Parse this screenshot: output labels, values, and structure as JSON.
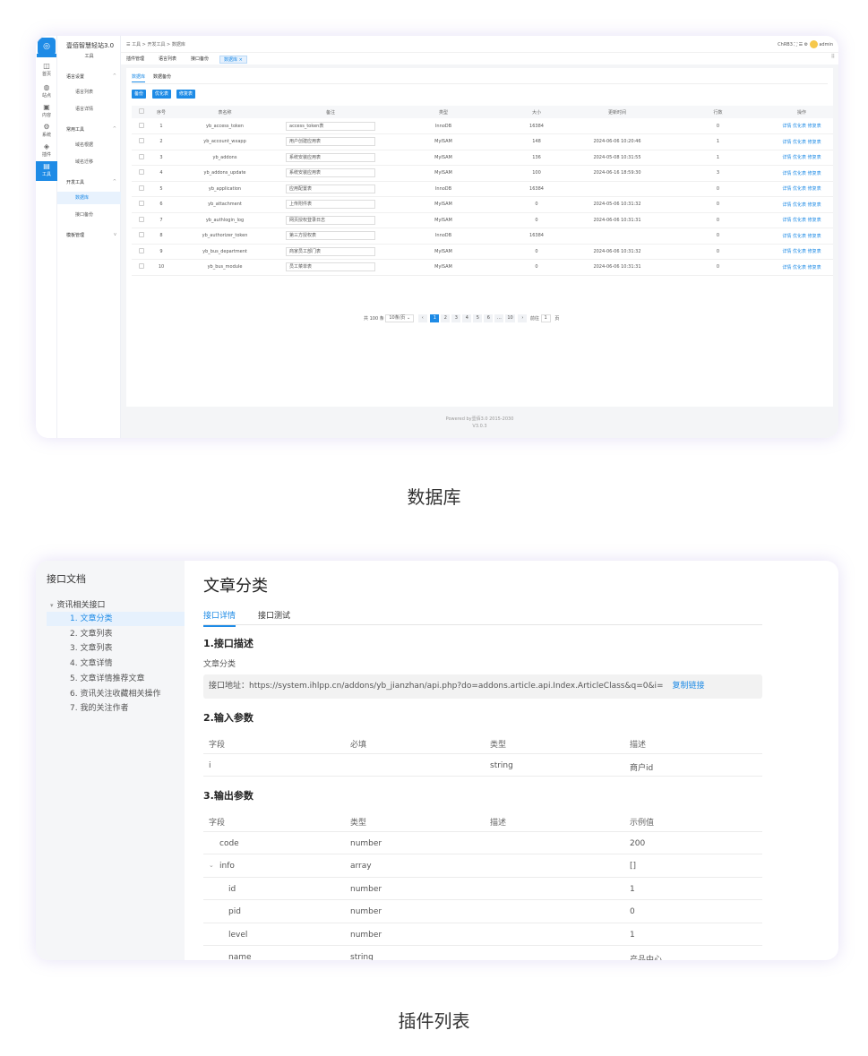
{
  "db": {
    "logo_label": "◎",
    "rail": [
      {
        "icon": "◫",
        "label": "首页"
      },
      {
        "icon": "◍",
        "label": "站点"
      },
      {
        "icon": "▣",
        "label": "内容"
      },
      {
        "icon": "⚙",
        "label": "系统"
      },
      {
        "icon": "◈",
        "label": "插件"
      },
      {
        "icon": "▤",
        "label": "工具"
      }
    ],
    "side_title": "壹佰智慧轻站3.0",
    "side_sub": "工具",
    "groups": [
      {
        "label": "语言设置",
        "items": [
          "语言列表",
          "语言详情"
        ]
      },
      {
        "label": "常用工具",
        "items": [
          "域名根据",
          "域名迁移"
        ]
      },
      {
        "label": "开发工具",
        "items": [
          "数据库",
          "接口备份"
        ]
      },
      {
        "label": "模板管理",
        "items": []
      }
    ],
    "breadcrumb": "工具 > 开发工具 > 数据库",
    "top_right": "ChRB3 ⛶ ☰ ⚙",
    "admin": "admin",
    "page_tabs": [
      "插件管理",
      "语言列表",
      "接口备份",
      "数据库 ×"
    ],
    "inner_tabs": [
      "数据库",
      "数据备份"
    ],
    "buttons": [
      "备份",
      "优化表",
      "修复表"
    ],
    "columns": [
      "",
      "序号",
      "表名称",
      "备注",
      "类型",
      "大小",
      "更新时间",
      "行数",
      "操作"
    ],
    "rows": [
      {
        "no": "1",
        "name": "yb_access_token",
        "remark": "access_token表",
        "type": "InnoDB",
        "size": "16384",
        "updated": "",
        "count": "0"
      },
      {
        "no": "2",
        "name": "yb_account_wxapp",
        "remark": "用户创建应用表",
        "type": "MyISAM",
        "size": "148",
        "updated": "2024-06-06 10:20:46",
        "count": "1"
      },
      {
        "no": "3",
        "name": "yb_addons",
        "remark": "系统安装应用表",
        "type": "MyISAM",
        "size": "136",
        "updated": "2024-05-08 10:31:55",
        "count": "1"
      },
      {
        "no": "4",
        "name": "yb_addons_update",
        "remark": "系统安装应用表",
        "type": "MyISAM",
        "size": "100",
        "updated": "2024-06-16 18:59:30",
        "count": "3"
      },
      {
        "no": "5",
        "name": "yb_application",
        "remark": "应用配置表",
        "type": "InnoDB",
        "size": "16384",
        "updated": "",
        "count": "0"
      },
      {
        "no": "6",
        "name": "yb_attachment",
        "remark": "上传附件表",
        "type": "MyISAM",
        "size": "0",
        "updated": "2024-05-06 10:31:32",
        "count": "0"
      },
      {
        "no": "7",
        "name": "yb_authlogin_log",
        "remark": "网页授权登录日志",
        "type": "MyISAM",
        "size": "0",
        "updated": "2024-06-06 10:31:31",
        "count": "0"
      },
      {
        "no": "8",
        "name": "yb_authorizer_token",
        "remark": "第三方授权表",
        "type": "InnoDB",
        "size": "16384",
        "updated": "",
        "count": "0"
      },
      {
        "no": "9",
        "name": "yb_bus_department",
        "remark": "商家员工部门表",
        "type": "MyISAM",
        "size": "0",
        "updated": "2024-06-06 10:31:32",
        "count": "0"
      },
      {
        "no": "10",
        "name": "yb_bus_module",
        "remark": "员工菜单表",
        "type": "MyISAM",
        "size": "0",
        "updated": "2024-06-06 10:31:31",
        "count": "0"
      }
    ],
    "ops": [
      "详情",
      "优化表",
      "修复表"
    ],
    "pager": {
      "total": "共 100 条",
      "size": "10条/页",
      "prev": "‹",
      "pages": [
        "1",
        "2",
        "3",
        "4",
        "5",
        "6",
        "…",
        "10"
      ],
      "next": "›",
      "goto": "前往",
      "goto_value": "1",
      "unit": "页"
    },
    "footer": "Powered by壹佰3.0 2015-2030",
    "version": "V3.0.3"
  },
  "caption1": "数据库",
  "doc": {
    "side_title": "接口文档",
    "group": "资讯相关接口",
    "items": [
      "1. 文章分类",
      "2. 文章列表",
      "3. 文章列表",
      "4. 文章详情",
      "5. 文章详情推荐文章",
      "6. 资讯关注收藏相关操作",
      "7. 我的关注作者"
    ],
    "title": "文章分类",
    "tabs": [
      "接口详情",
      "接口测试"
    ],
    "h1": "1.接口描述",
    "desc": "文章分类",
    "addr_label": "接口地址：",
    "addr": "https://system.ihlpp.cn/addons/yb_jianzhan/api.php?do=addons.article.api.Index.ArticleClass&q=0&i=",
    "copy": "复制链接",
    "h2": "2.输入参数",
    "in_cols": [
      "字段",
      "必填",
      "类型",
      "描述"
    ],
    "in_rows": [
      [
        "i",
        "",
        "string",
        "商户id"
      ]
    ],
    "h3": "3.输出参数",
    "out_cols": [
      "字段",
      "类型",
      "描述",
      "示例值"
    ],
    "out_rows": [
      [
        "code",
        "number",
        "",
        "200"
      ],
      [
        "info",
        "array",
        "",
        "[]"
      ],
      [
        "id",
        "number",
        "",
        "1"
      ],
      [
        "pid",
        "number",
        "",
        "0"
      ],
      [
        "level",
        "number",
        "",
        "1"
      ],
      [
        "name",
        "string",
        "",
        "产品中心"
      ]
    ]
  },
  "caption2": "插件列表"
}
